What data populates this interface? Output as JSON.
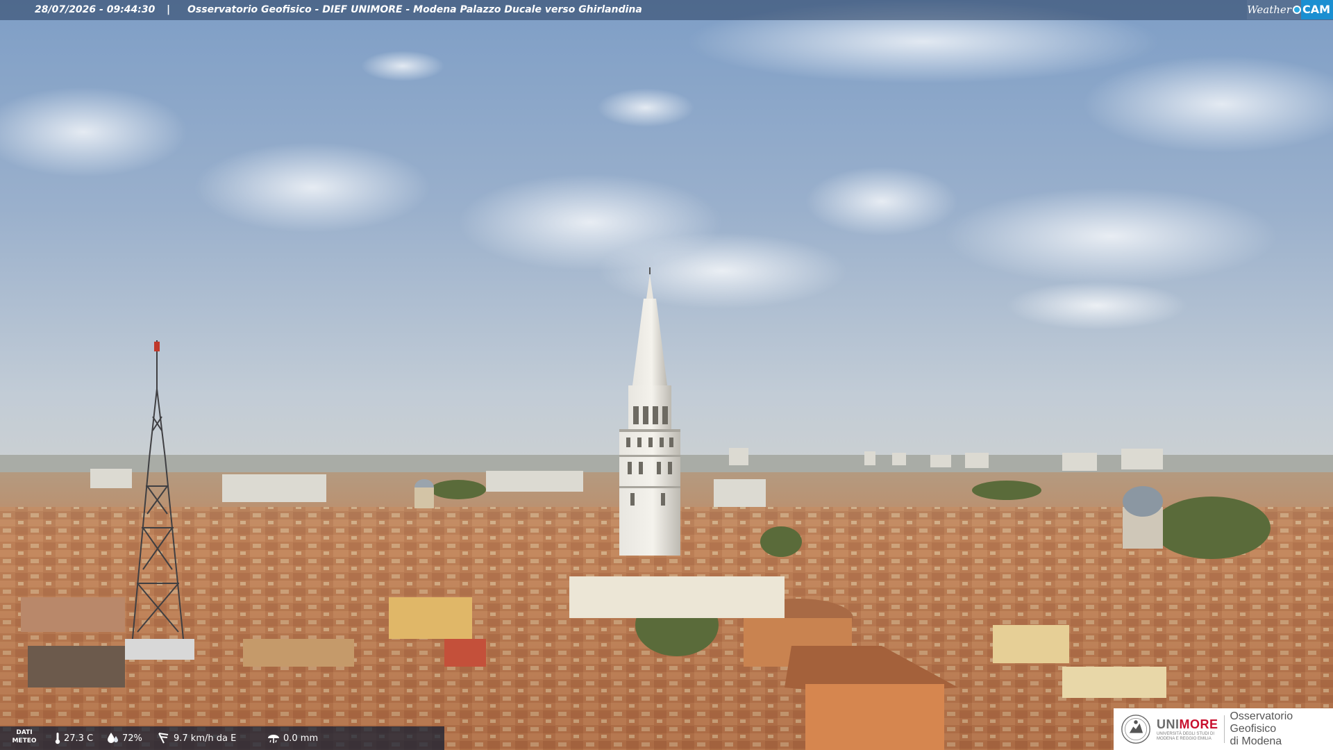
{
  "header": {
    "timestamp": "28/07/2026 - 09:44:30",
    "separator": "|",
    "title": "Osservatorio Geofisico - DIEF UNIMORE - Modena Palazzo Ducale verso Ghirlandina"
  },
  "brand": {
    "weather": "Weather",
    "cam": "CAM"
  },
  "weather_bar": {
    "label_line1": "DATI",
    "label_line2": "METEO",
    "temperature": "27.3 C",
    "humidity": "72%",
    "wind": "9.7 km/h da E",
    "rain": "0.0 mm"
  },
  "sponsor": {
    "uni_prefix": "UNI",
    "uni_suffix": "MORE",
    "uni_subtitle": "UNIVERSITÀ DEGLI STUDI DI MODENA E REGGIO EMILIA",
    "observatory_line1": "Osservatorio Geofisico",
    "observatory_line2": "di Modena"
  },
  "colors": {
    "sky_top": "#7f9fc7",
    "sky_horizon": "#c3ccd3",
    "roofs": "#b97a52",
    "unimore_red": "#c8102e"
  }
}
